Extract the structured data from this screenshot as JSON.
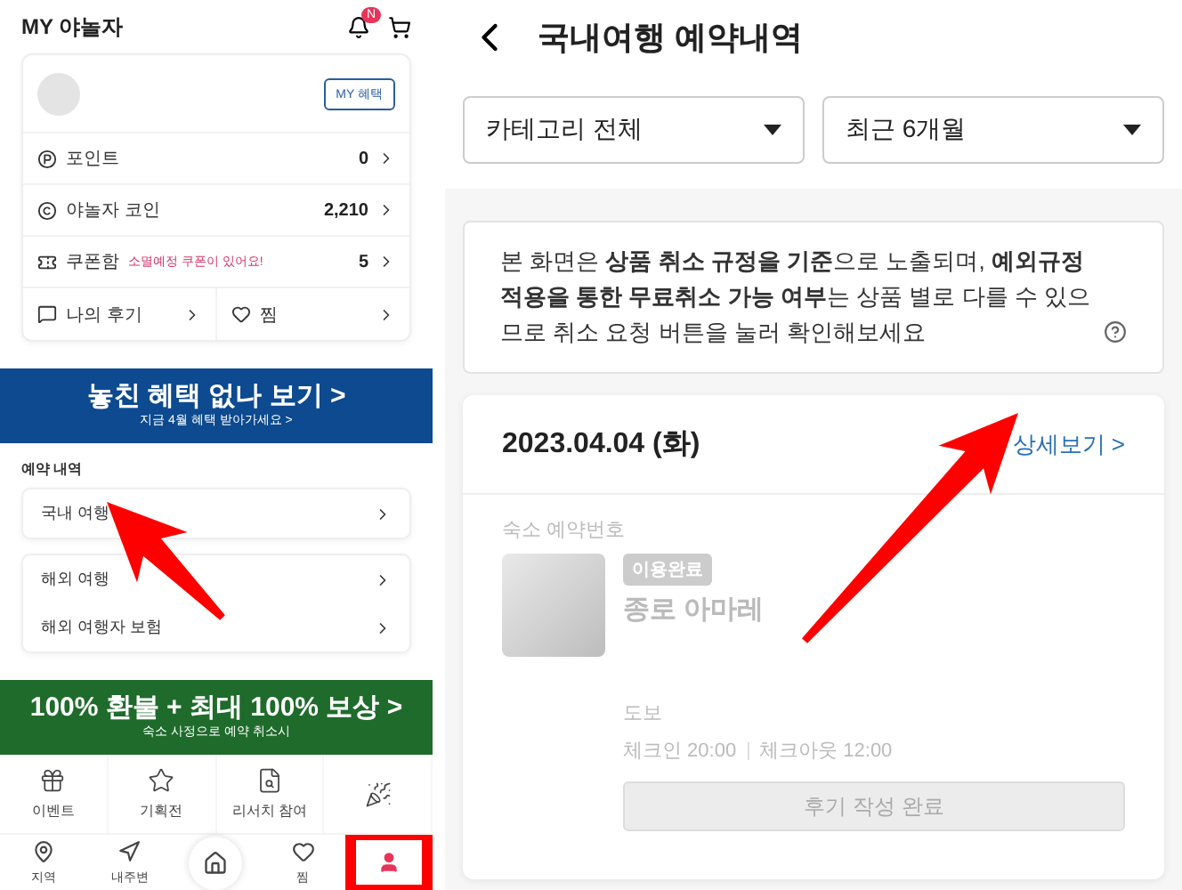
{
  "left": {
    "title": "MY 야놀자",
    "notification_badge": "N",
    "card": {
      "benefit_button": "MY 혜택",
      "rows": [
        {
          "kind": "point",
          "label": "포인트",
          "value": "0"
        },
        {
          "kind": "coin",
          "label": "야놀자 코인",
          "value": "2,210"
        },
        {
          "kind": "coupon",
          "label": "쿠폰함",
          "note": "소멸예정 쿠폰이 있어요!",
          "value": "5"
        }
      ],
      "links": [
        {
          "kind": "review",
          "label": "나의 후기"
        },
        {
          "kind": "wish",
          "label": "찜"
        }
      ]
    },
    "promo_banner": {
      "title": "놓친 혜택 없나 보기 >",
      "subtitle": "지금 4월 혜택 받아가세요 >"
    },
    "reservations": {
      "heading": "예약 내역",
      "groups": [
        {
          "items": [
            {
              "label": "국내 여행"
            }
          ]
        },
        {
          "items": [
            {
              "label": "해외 여행"
            },
            {
              "label": "해외 여행자 보험"
            }
          ]
        }
      ]
    },
    "refund_banner": {
      "title": "100% 환불 + 최대 100% 보상 >",
      "subtitle": "숙소 사정으로 예약 취소시"
    },
    "quick_menu": [
      {
        "kind": "gift",
        "label": "이벤트"
      },
      {
        "kind": "star",
        "label": "기획전"
      },
      {
        "kind": "research",
        "label": "리서치 참여"
      },
      {
        "kind": "party"
      }
    ],
    "bottom_nav": [
      {
        "kind": "map",
        "label": "지역",
        "highlighted": false
      },
      {
        "kind": "nearby",
        "label": "내주변",
        "highlighted": false
      },
      {
        "kind": "home",
        "highlighted": false
      },
      {
        "kind": "heart",
        "label": "찜",
        "highlighted": false
      },
      {
        "kind": "my",
        "highlighted": true
      }
    ]
  },
  "right": {
    "title": "국내여행 예약내역",
    "filters": [
      {
        "value": "카테고리 전체"
      },
      {
        "value": "최근 6개월"
      }
    ],
    "notice": "본 화면은 **상품 취소 규정을 기준**으로 노출되며, **예외규정 적용을 통한 무료취소 가능 여부**는 상품 별로 다를 수 있으므로 취소 요청 버튼을 눌러 확인해보세요",
    "booking": {
      "date": "2023.04.04 (화)",
      "detail_link": "상세보기 >",
      "number_label": "숙소 예약번호",
      "status": "이용완료",
      "name": "종로 아마레",
      "access": "도보",
      "checkin": "체크인 20:00",
      "checkout": "체크아웃 12:00",
      "review_button": {
        "label": "후기 작성 완료",
        "disabled": true
      }
    }
  }
}
